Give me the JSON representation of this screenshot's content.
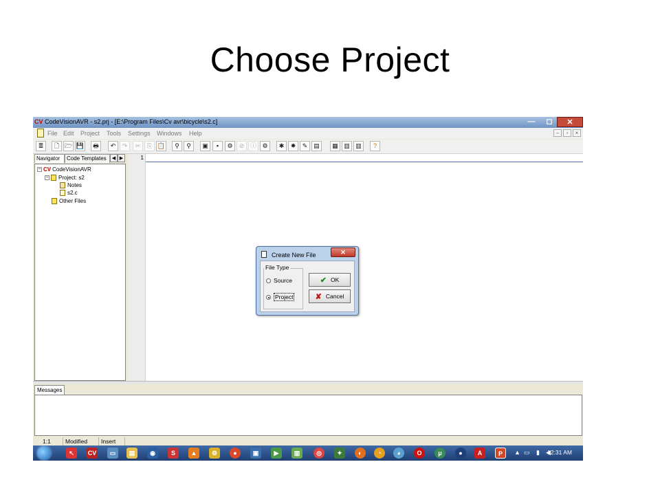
{
  "slide": {
    "title": "Choose Project"
  },
  "window": {
    "title": "CodeVisionAVR - s2.prj - [E:\\Program Files\\Cv avr\\bicycle\\s2.c]",
    "controls": {
      "minimize": "—",
      "maximize": "◻",
      "close": "✕"
    }
  },
  "menu": {
    "items": [
      "File",
      "Edit",
      "Project",
      "Tools",
      "Settings",
      "Windows",
      "Help"
    ],
    "mdi_controls": [
      "–",
      "▫",
      "×"
    ]
  },
  "toolbar": {
    "icons": [
      "project-tree-icon",
      "new-file-icon",
      "open-icon",
      "save-icon",
      "print-icon",
      "undo-icon",
      "redo-icon",
      "cut-icon",
      "copy-icon",
      "paste-icon",
      "find-icon",
      "find-next-icon",
      "make-icon",
      "chip-icon",
      "build-icon",
      "stop-icon",
      "info-icon",
      "programmer-icon",
      "settings-icon",
      "debug-icon",
      "tool-icon",
      "terminal-icon",
      "window-tile-icon",
      "window-cascade-icon",
      "window-arrange-icon",
      "help-icon"
    ],
    "glyphs": [
      "≣",
      "🗋",
      "🗁",
      "💾",
      "🖶",
      "↶",
      "↷",
      "✂",
      "⎘",
      "📋",
      "⚲",
      "⚲",
      "▣",
      "▪",
      "⚙",
      "⊘",
      "ⓘ",
      "⚙",
      "✱",
      "✸",
      "✎",
      "▤",
      "▦",
      "▥",
      "▥",
      "?"
    ]
  },
  "navigator": {
    "tabs": [
      "Navigator",
      "Code Templates"
    ],
    "arrows": [
      "◀",
      "▶"
    ],
    "tree": [
      {
        "label": "CodeVisionAVR",
        "level": 0,
        "expander": "−",
        "icon": "codevision-icon"
      },
      {
        "label": "Project: s2",
        "level": 1,
        "expander": "−",
        "icon": "project-icon"
      },
      {
        "label": "Notes",
        "level": 2,
        "icon": "notes-icon"
      },
      {
        "label": "s2.c",
        "level": 2,
        "icon": "file-icon"
      },
      {
        "label": "Other Files",
        "level": 1,
        "icon": "folder-icon"
      }
    ]
  },
  "editor": {
    "line_number": "1"
  },
  "messages": {
    "tab": "Messages"
  },
  "statusbar": {
    "position": "1:1",
    "modified": "Modified",
    "mode": "Insert"
  },
  "taskbar": {
    "clock": "12:31 AM"
  },
  "dialog": {
    "title": "Create New File",
    "close": "✕",
    "group_label": "File Type",
    "options": [
      {
        "label": "Source",
        "selected": false
      },
      {
        "label": "Project",
        "selected": true
      }
    ],
    "ok_label": "OK",
    "cancel_label": "Cancel",
    "ok_glyph": "✔",
    "cancel_glyph": "✘"
  },
  "colors": {
    "title_gradient_top": "#a6c1e0",
    "close_red": "#c44a3a",
    "taskbar": "#2a4f88"
  }
}
